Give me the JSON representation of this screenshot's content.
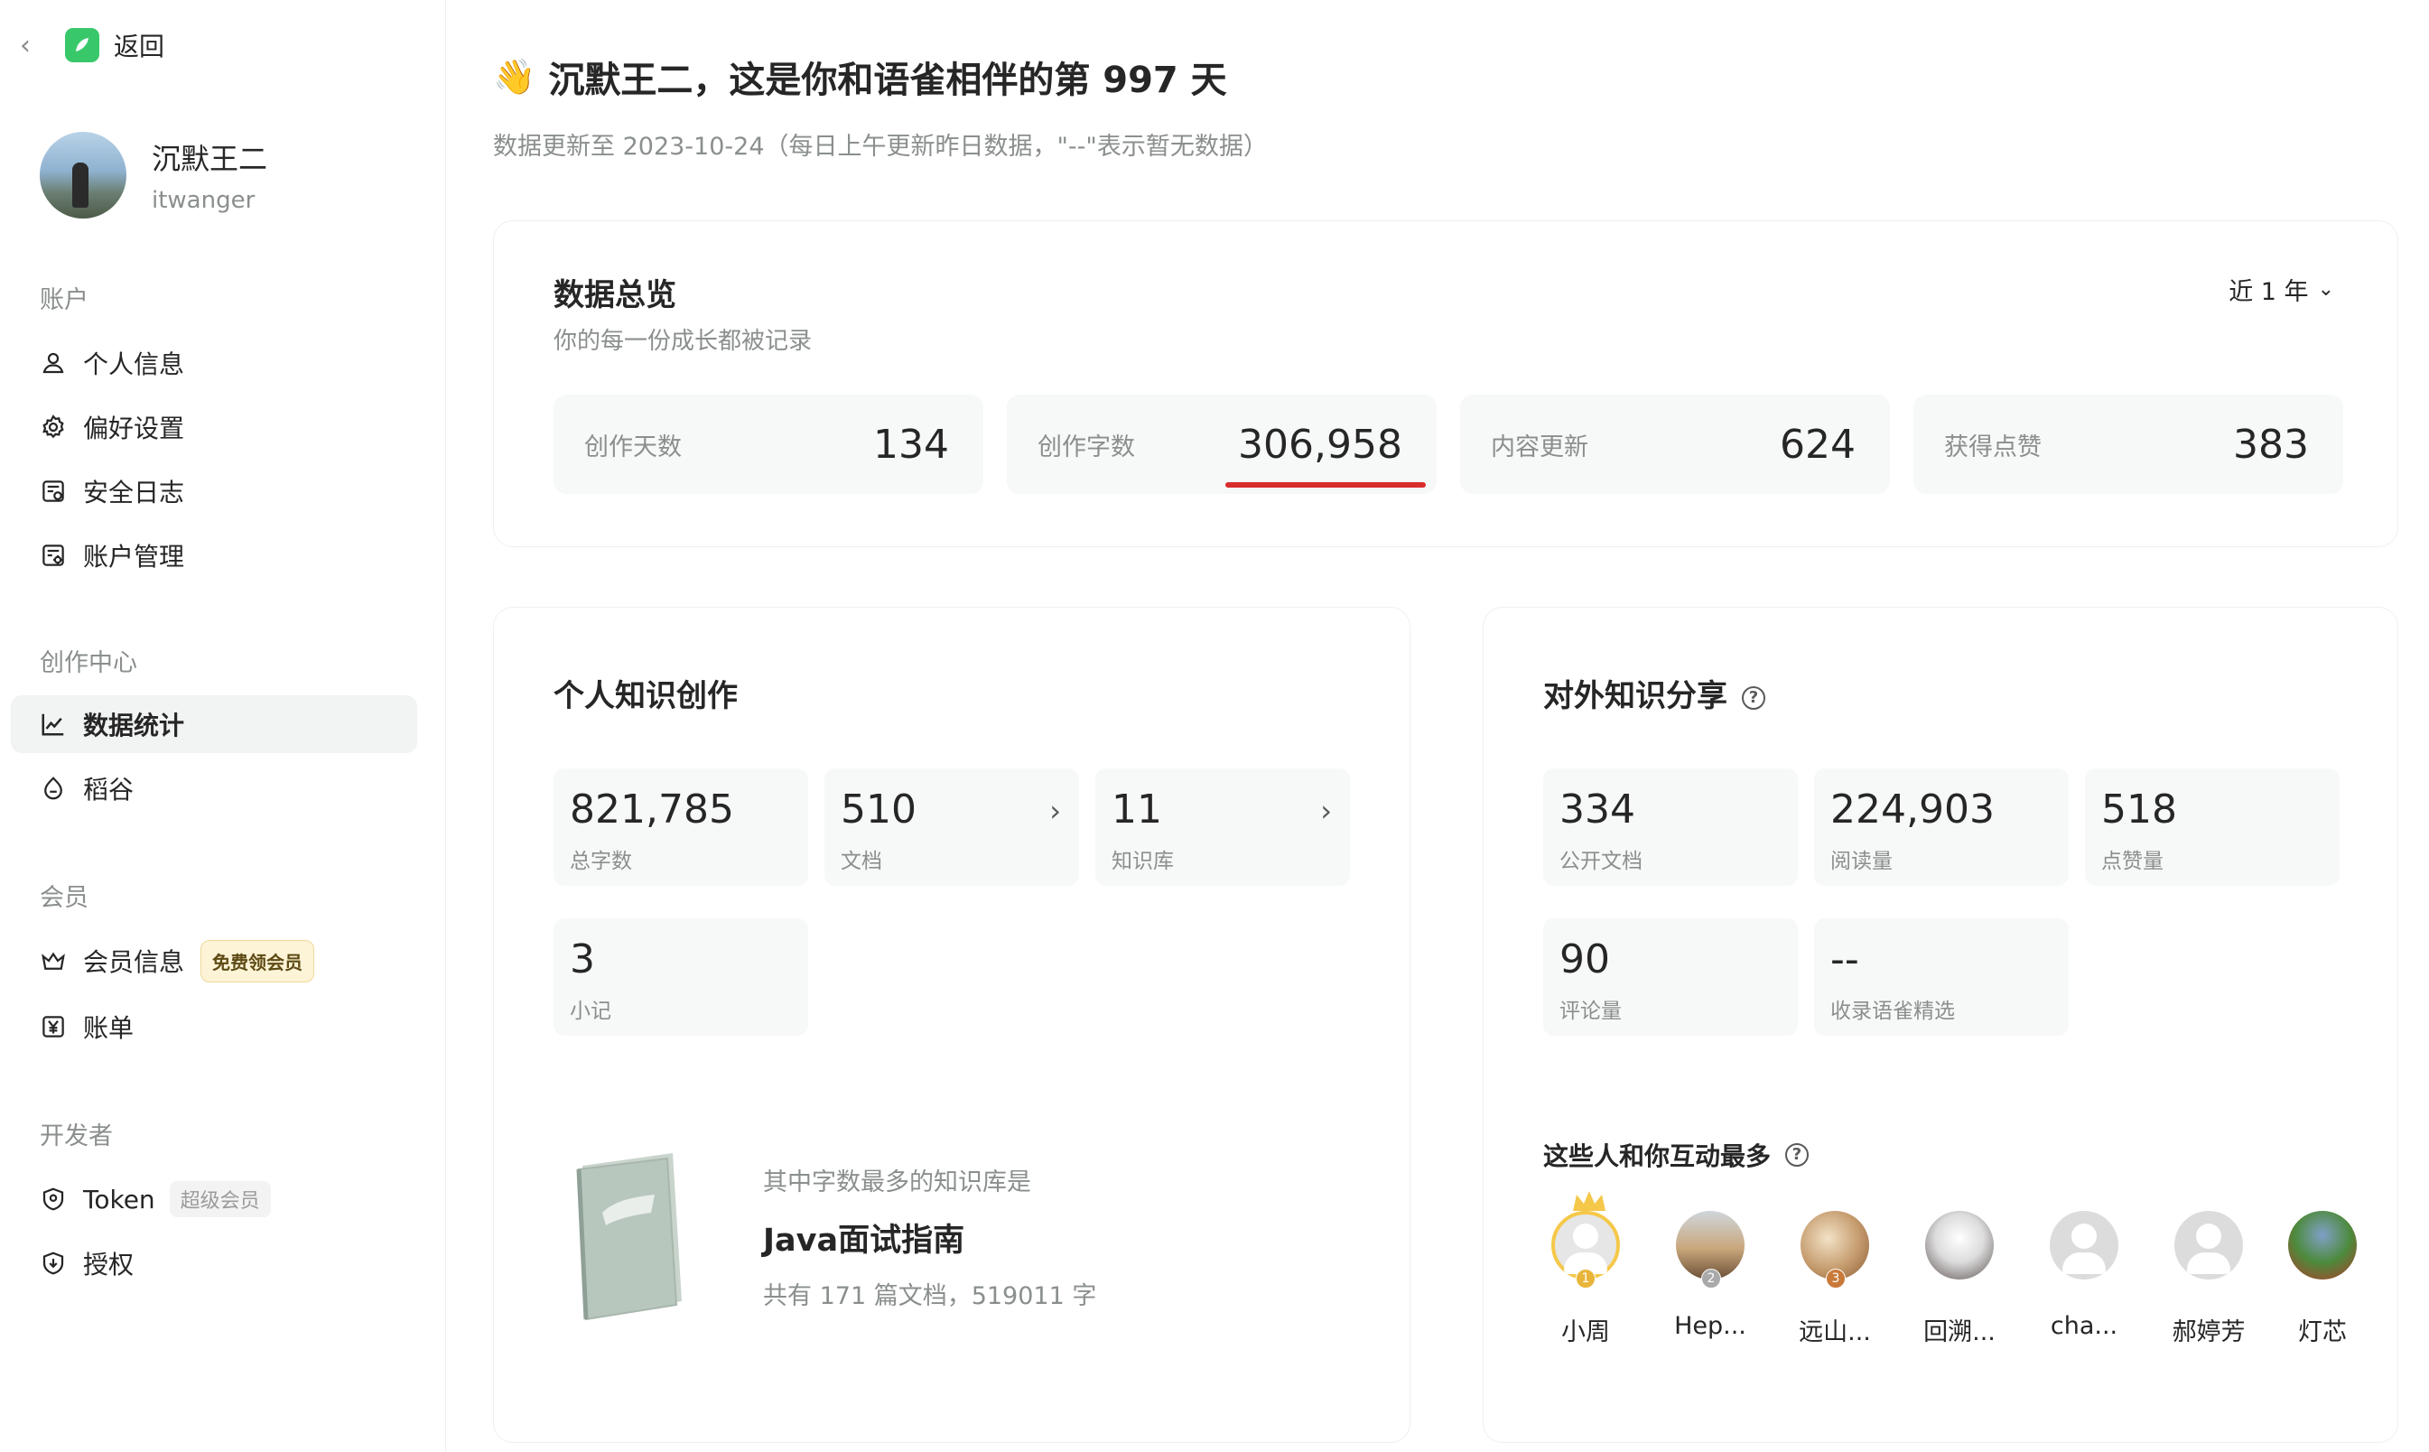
{
  "nav": {
    "back_label": "返回"
  },
  "user": {
    "nickname": "沉默王二",
    "login": "itwanger"
  },
  "sidebar": {
    "sections": [
      {
        "title": "账户",
        "items": [
          {
            "label": "个人信息",
            "icon": "user-icon"
          },
          {
            "label": "偏好设置",
            "icon": "gear-icon"
          },
          {
            "label": "安全日志",
            "icon": "log-icon"
          },
          {
            "label": "账户管理",
            "icon": "account-manage-icon"
          }
        ]
      },
      {
        "title": "创作中心",
        "items": [
          {
            "label": "数据统计",
            "icon": "chart-line-icon",
            "active": true
          },
          {
            "label": "稻谷",
            "icon": "grain-icon"
          }
        ]
      },
      {
        "title": "会员",
        "items": [
          {
            "label": "会员信息",
            "icon": "crown-icon",
            "badge": "免费领会员"
          },
          {
            "label": "账单",
            "icon": "yuan-bill-icon"
          }
        ]
      },
      {
        "title": "开发者",
        "items": [
          {
            "label": "Token",
            "icon": "shield-icon",
            "badge": "超级会员"
          },
          {
            "label": "授权",
            "icon": "authorize-icon"
          }
        ]
      }
    ]
  },
  "header": {
    "greeting": "沉默王二，这是你和语雀相伴的第 997 天",
    "update_note": "数据更新至 2023-10-24（每日上午更新昨日数据，\"--\"表示暂无数据）"
  },
  "overview": {
    "title": "数据总览",
    "subtitle": "你的每一份成长都被记录",
    "range": "近 1 年",
    "stats": [
      {
        "label": "创作天数",
        "value": "134"
      },
      {
        "label": "创作字数",
        "value": "306,958"
      },
      {
        "label": "内容更新",
        "value": "624"
      },
      {
        "label": "获得点赞",
        "value": "383"
      }
    ]
  },
  "personal": {
    "title": "个人知识创作",
    "tiles": [
      {
        "value": "821,785",
        "label": "总字数"
      },
      {
        "value": "510",
        "label": "文档"
      },
      {
        "value": "11",
        "label": "知识库"
      },
      {
        "value": "3",
        "label": "小记"
      }
    ],
    "top_repo": {
      "caption": "其中字数最多的知识库是",
      "name": "Java面试指南",
      "meta": "共有 171 篇文档，519011 字"
    }
  },
  "share": {
    "title": "对外知识分享",
    "tiles": [
      {
        "value": "334",
        "label": "公开文档"
      },
      {
        "value": "224,903",
        "label": "阅读量"
      },
      {
        "value": "518",
        "label": "点赞量"
      },
      {
        "value": "90",
        "label": "评论量"
      },
      {
        "value": "--",
        "label": "收录语雀精选"
      }
    ],
    "interact_title": "这些人和你互动最多",
    "people": [
      {
        "name": "小周",
        "rank": "1"
      },
      {
        "name": "Hep...",
        "rank": "2"
      },
      {
        "name": "远山...",
        "rank": "3"
      },
      {
        "name": "回溯..."
      },
      {
        "name": "cha..."
      },
      {
        "name": "郝婷芳"
      },
      {
        "name": "灯芯"
      }
    ]
  },
  "colors": {
    "accent_green": "#38c86a",
    "underline_red": "#d92c2c",
    "tile_bg": "#f7f8f8"
  }
}
